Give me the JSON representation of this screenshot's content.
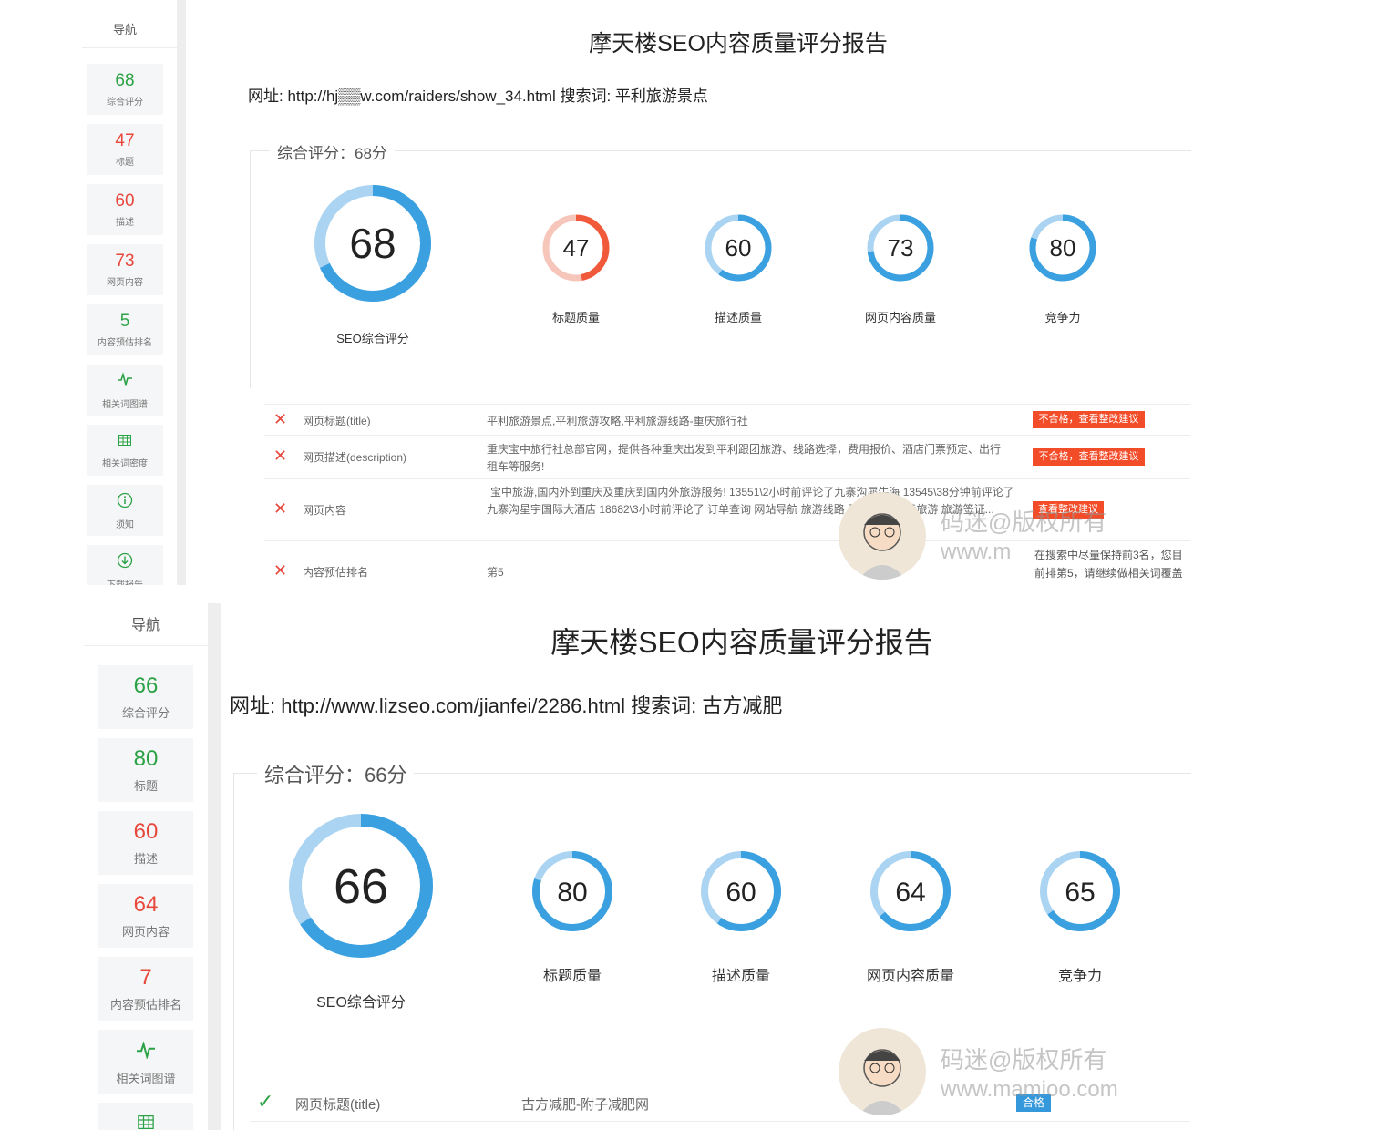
{
  "colors": {
    "ring_blue": "#3aa0e0",
    "ring_light": "#aad4f2",
    "ring_red": "#f05a3a",
    "ring_pink": "#f7c6bb",
    "pass_green": "#2ba245",
    "fail_red": "#e8473c"
  },
  "report_top": {
    "nav_title": "导航",
    "nav_items": [
      {
        "value": "68",
        "label": "综合评分",
        "color": "green"
      },
      {
        "value": "47",
        "label": "标题",
        "color": "red"
      },
      {
        "value": "60",
        "label": "描述",
        "color": "red"
      },
      {
        "value": "73",
        "label": "网页内容",
        "color": "red"
      },
      {
        "value": "5",
        "label": "内容预估排名",
        "color": "green"
      },
      {
        "icon": "pulse-icon",
        "label": "相关词图谱"
      },
      {
        "icon": "grid-icon",
        "label": "相关词密度"
      },
      {
        "icon": "info-circle-icon",
        "label": "须知"
      },
      {
        "icon": "download-circle-icon",
        "label": "下载报告"
      }
    ],
    "title": "摩天楼SEO内容质量评分报告",
    "url_line": "网址: http://hj▒▒w.com/raiders/show_34.html 搜索词: 平利旅游景点",
    "score_legend": "综合评分：68分",
    "main_gauge": {
      "value": 68,
      "label": "SEO综合评分"
    },
    "gauges": [
      {
        "value": 47,
        "label": "标题质量",
        "tone": "red"
      },
      {
        "value": 60,
        "label": "描述质量",
        "tone": "blue"
      },
      {
        "value": 73,
        "label": "网页内容质量",
        "tone": "blue"
      },
      {
        "value": 80,
        "label": "竞争力",
        "tone": "blue"
      }
    ],
    "rows": [
      {
        "status": "fail",
        "label": "网页标题(title)",
        "value": "平利旅游景点,平利旅游攻略,平利旅游线路-重庆旅行社",
        "badge": "不合格，查看整改建议"
      },
      {
        "status": "fail",
        "label": "网页描述(description)",
        "value": "重庆宝中旅行社总部官网，提供各种重庆出发到平利跟团旅游、线路选择，费用报价、酒店门票预定、出行租车等服务!",
        "badge": "不合格，查看整改建议"
      },
      {
        "status": "fail",
        "label": "网页内容",
        "value": "宝中旅游,国内外到重庆及重庆到国内外旅游服务!  13551\\2小时前评论了九寨沟犀牛海 13545\\38分钟前评论了九寨沟星宇国际大酒店 18682\\3小时前评论了 订单查询 网站导航 旅游线路 国内旅游 出境旅游 旅游签证...",
        "badge": "查看整改建议"
      },
      {
        "status": "fail",
        "label": "内容预估排名",
        "value": "第5",
        "note": "在搜索中尽量保持前3名，您目前排第5，请继续做相关词覆盖"
      }
    ],
    "watermark_cn": "码迷@版权所有",
    "watermark_url": "www.m"
  },
  "report_bottom": {
    "nav_title": "导航",
    "nav_items": [
      {
        "value": "66",
        "label": "综合评分",
        "color": "green"
      },
      {
        "value": "80",
        "label": "标题",
        "color": "green"
      },
      {
        "value": "60",
        "label": "描述",
        "color": "red"
      },
      {
        "value": "64",
        "label": "网页内容",
        "color": "red"
      },
      {
        "value": "7",
        "label": "内容预估排名",
        "color": "red"
      },
      {
        "icon": "pulse-icon",
        "label": "相关词图谱"
      },
      {
        "icon": "grid-icon",
        "label": ""
      }
    ],
    "title": "摩天楼SEO内容质量评分报告",
    "url_line": "网址: http://www.lizseo.com/jianfei/2286.html 搜索词: 古方减肥",
    "score_legend": "综合评分：66分",
    "main_gauge": {
      "value": 66,
      "label": "SEO综合评分"
    },
    "gauges": [
      {
        "value": 80,
        "label": "标题质量",
        "tone": "blue"
      },
      {
        "value": 60,
        "label": "描述质量",
        "tone": "blue"
      },
      {
        "value": 64,
        "label": "网页内容质量",
        "tone": "blue"
      },
      {
        "value": 65,
        "label": "竞争力",
        "tone": "blue"
      }
    ],
    "rows": [
      {
        "status": "pass",
        "label": "网页标题(title)",
        "value": "古方减肥-附子减肥网",
        "badge": "合格"
      }
    ],
    "watermark_cn": "码迷@版权所有",
    "watermark_url": "www.mamioo.com"
  }
}
